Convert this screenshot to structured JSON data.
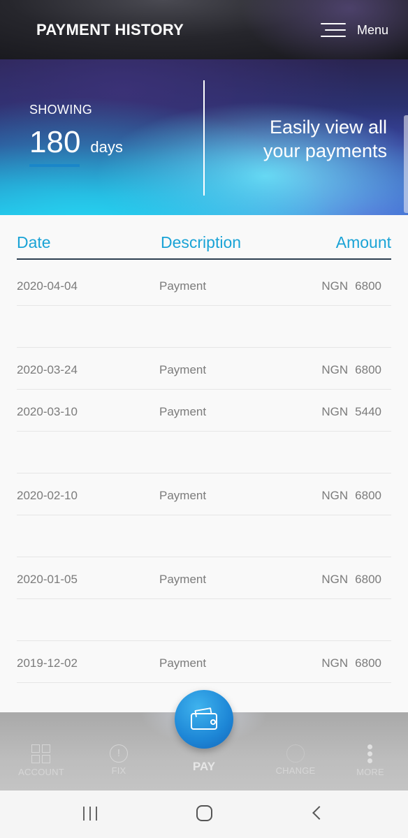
{
  "header": {
    "title": "PAYMENT HISTORY",
    "menu_label": "Menu"
  },
  "banner": {
    "showing_label": "SHOWING",
    "days_value": "180",
    "days_unit": "days",
    "tagline_line1": "Easily view all",
    "tagline_line2": "your payments"
  },
  "table": {
    "headers": {
      "date": "Date",
      "description": "Description",
      "amount": "Amount"
    },
    "rows": [
      {
        "date": "2020-04-04",
        "description": "Payment",
        "currency": "NGN",
        "amount": "6800"
      },
      {
        "date": "",
        "description": "",
        "currency": "",
        "amount": ""
      },
      {
        "date": "2020-03-24",
        "description": "Payment",
        "currency": "NGN",
        "amount": "6800"
      },
      {
        "date": "2020-03-10",
        "description": "Payment",
        "currency": "NGN",
        "amount": "5440"
      },
      {
        "date": "",
        "description": "",
        "currency": "",
        "amount": ""
      },
      {
        "date": "2020-02-10",
        "description": "Payment",
        "currency": "NGN",
        "amount": "6800"
      },
      {
        "date": "",
        "description": "",
        "currency": "",
        "amount": ""
      },
      {
        "date": "2020-01-05",
        "description": "Payment",
        "currency": "NGN",
        "amount": "6800"
      },
      {
        "date": "",
        "description": "",
        "currency": "",
        "amount": ""
      },
      {
        "date": "2019-12-02",
        "description": "Payment",
        "currency": "NGN",
        "amount": "6800"
      }
    ]
  },
  "bottom_nav": {
    "account": "ACCOUNT",
    "fix": "FIX",
    "pay": "PAY",
    "change": "CHANGE",
    "more": "MORE",
    "fix_icon_glyph": "!"
  },
  "colors": {
    "accent": "#1aa3d6",
    "header_bg": "#1c1c22",
    "pay_button": "#1d86d6"
  },
  "icons": {
    "menu": "hamburger-icon",
    "pay": "wallet-icon",
    "account": "grid-icon",
    "fix": "alert-circle-icon",
    "change": "change-icon",
    "more": "more-vertical-icon"
  }
}
